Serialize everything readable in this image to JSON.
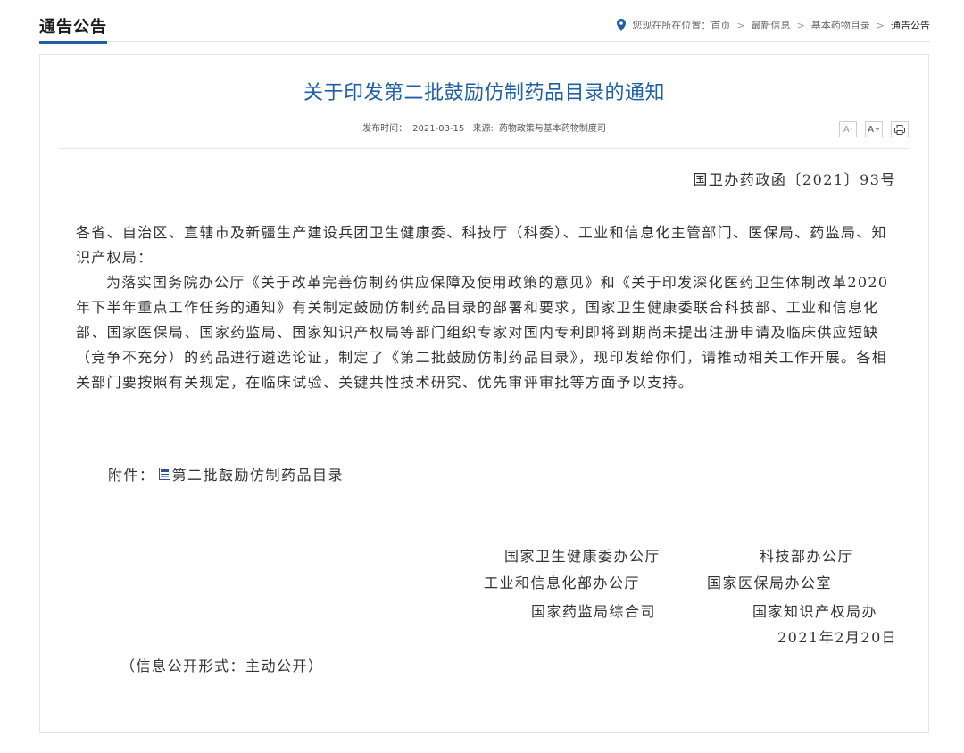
{
  "header": {
    "section_title": "通告公告",
    "breadcrumb_prefix": "您现在所在位置：",
    "breadcrumb": [
      "首页",
      "最新信息",
      "基本药物目录",
      "通告公告"
    ]
  },
  "article": {
    "title": "关于印发第二批鼓励仿制药品目录的通知",
    "publish_label": "发布时间：",
    "publish_date": "2021-03-15",
    "source_label": "来源:",
    "source": "药物政策与基本药物制度司",
    "tools": {
      "font_smaller": "A",
      "font_larger": "A",
      "minus": "-",
      "plus": "+"
    },
    "doc_number": "国卫办药政函〔2021〕93号",
    "addressees": "各省、自治区、直辖市及新疆生产建设兵团卫生健康委、科技厅（科委）、工业和信息化主管部门、医保局、药监局、知识产权局：",
    "body": "为落实国务院办公厅《关于改革完善仿制药供应保障及使用政策的意见》和《关于印发深化医药卫生体制改革2020年下半年重点工作任务的通知》有关制定鼓励仿制药品目录的部署和要求，国家卫生健康委联合科技部、工业和信息化部、国家医保局、国家药监局、国家知识产权局等部门组织专家对国内专利即将到期尚未提出注册申请及临床供应短缺（竞争不充分）的药品进行遴选论证，制定了《第二批鼓励仿制药品目录》，现印发给你们，请推动相关工作开展。各相关部门要按照有关规定，在临床试验、关键共性技术研究、优先审评审批等方面予以支持。",
    "attachment_label": "附件：",
    "attachment_name": "第二批鼓励仿制药品目录",
    "signatures": [
      "国家卫生健康委办公厅",
      "科技部办公厅",
      "工业和信息化部办公厅",
      "国家医保局办公室",
      "国家药监局综合司",
      "国家知识产权局办"
    ],
    "date": "2021年2月20日",
    "open_form": "（信息公开形式：主动公开）"
  },
  "colors": {
    "accent": "#1f5fa6",
    "text": "#333333"
  }
}
